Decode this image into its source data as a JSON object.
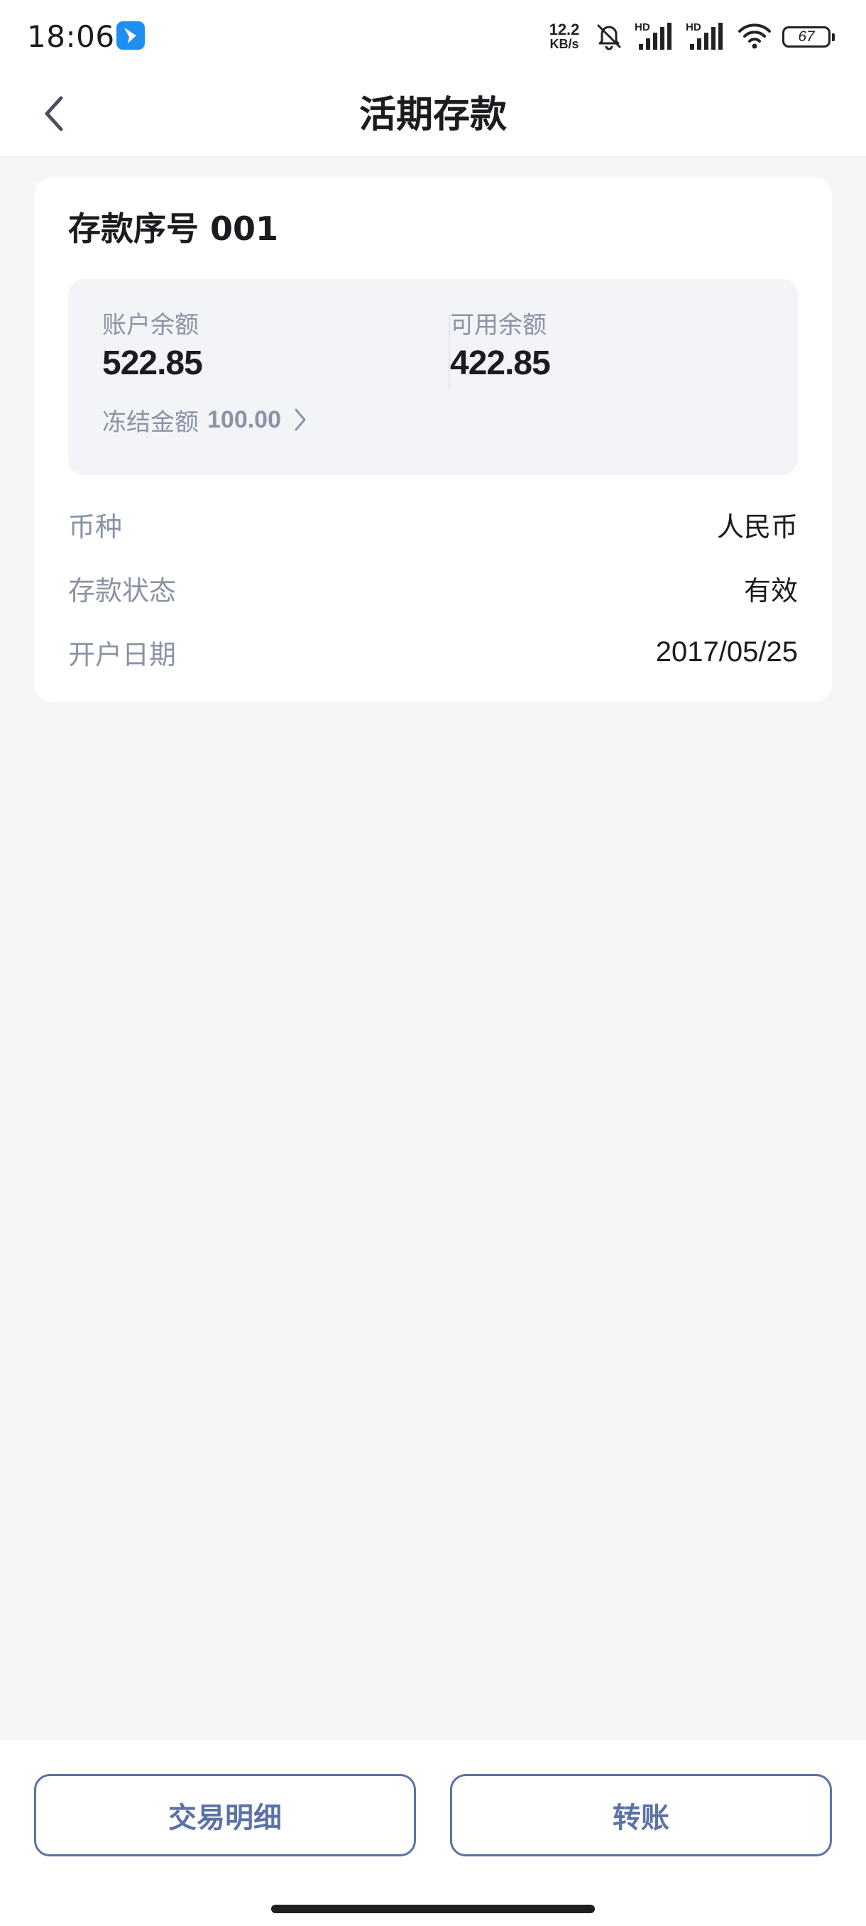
{
  "status_bar": {
    "time": "18:06",
    "net_speed_value": "12.2",
    "net_speed_unit": "KB/s",
    "signal_label_1": "HD",
    "signal_label_2": "HD",
    "battery": "67",
    "app_icon": "feishu-app-icon"
  },
  "nav": {
    "title": "活期存款",
    "back_icon": "chevron-left-icon"
  },
  "card": {
    "title": "存款序号 001",
    "balance": {
      "account_balance_label": "账户余额",
      "account_balance_value": "522.85",
      "available_balance_label": "可用余额",
      "available_balance_value": "422.85",
      "frozen_label": "冻结金额",
      "frozen_value": "100.00"
    },
    "details": [
      {
        "label": "币种",
        "value": "人民币"
      },
      {
        "label": "存款状态",
        "value": "有效"
      },
      {
        "label": "开户日期",
        "value": "2017/05/25"
      }
    ]
  },
  "actions": {
    "transactions_label": "交易明细",
    "transfer_label": "转账"
  },
  "colors": {
    "accent": "#5b72a6",
    "muted_text": "#8b93a6",
    "page_bg": "#f5f6f8",
    "panel_bg": "#f3f4f7"
  }
}
